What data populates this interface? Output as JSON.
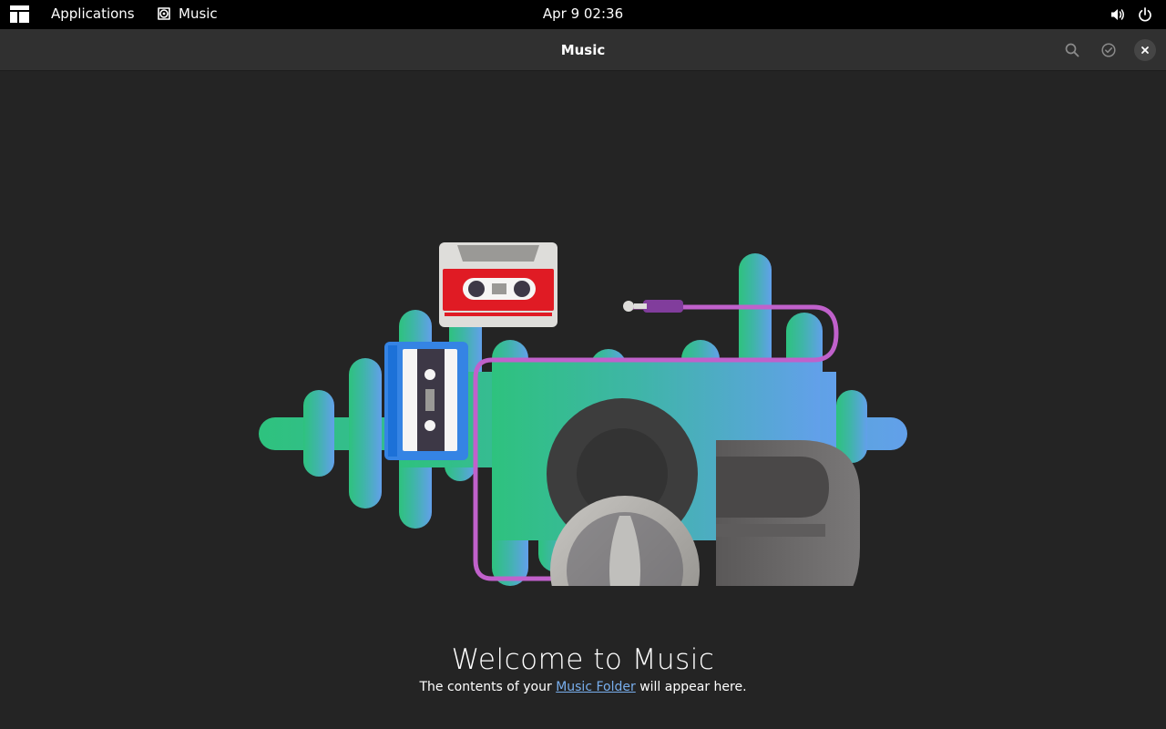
{
  "topbar": {
    "activities_icon": "activities-icon",
    "applications_label": "Applications",
    "app_name": "Music",
    "clock": "Apr 9  02:36",
    "volume_icon": "volume-icon",
    "power_icon": "power-icon"
  },
  "headerbar": {
    "title": "Music",
    "search_icon": "search-icon",
    "select_icon": "selection-check-icon",
    "close_icon": "close-icon"
  },
  "empty_state": {
    "title": "Welcome to Music",
    "subtitle_prefix": "The contents of your ",
    "link_text": "Music Folder",
    "subtitle_suffix": " will appear here."
  },
  "colors": {
    "window_bg": "#242424",
    "headerbar_bg": "#303030",
    "topbar_bg": "#000000",
    "link": "#78aeed",
    "wave_start": "#2ec27e",
    "wave_end": "#62a0ea",
    "cable": "#c061cb"
  }
}
